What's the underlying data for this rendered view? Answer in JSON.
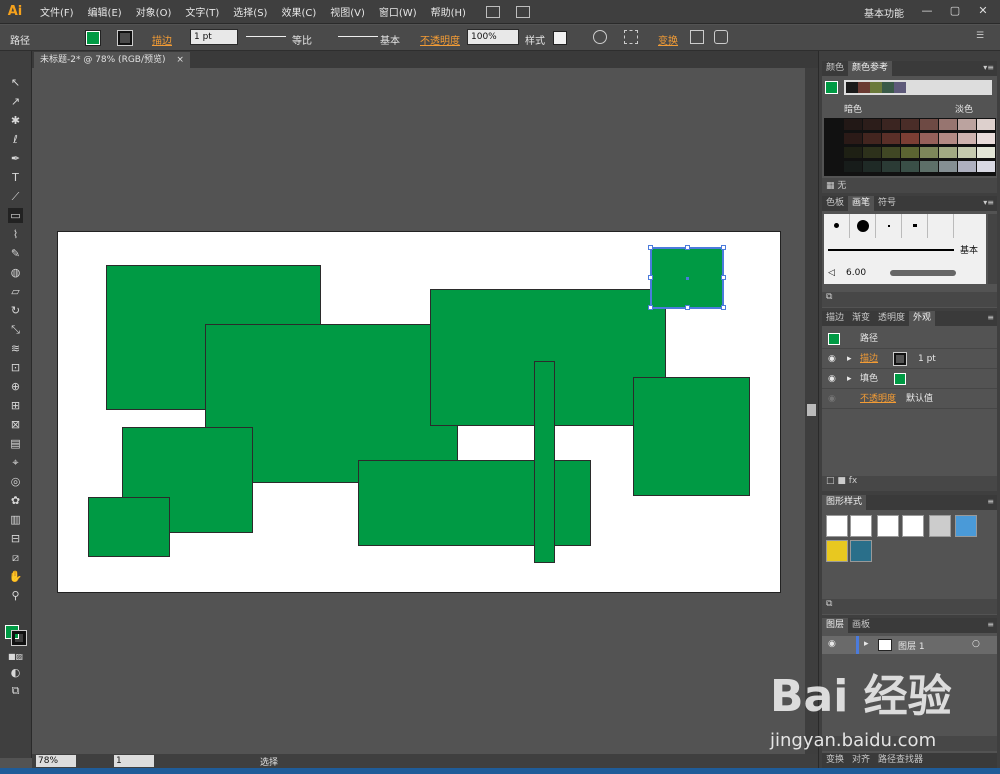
{
  "app": {
    "logo": "Ai",
    "workspace": "基本功能"
  },
  "menubar": {
    "items": [
      "文件(F)",
      "编辑(E)",
      "对象(O)",
      "文字(T)",
      "选择(S)",
      "效果(C)",
      "视图(V)",
      "窗口(W)",
      "帮助(H)"
    ]
  },
  "window_controls": {
    "minimize": "—",
    "maximize": "▢",
    "close": "✕"
  },
  "controlbar": {
    "object_type": "路径",
    "stroke_label": "描边",
    "stroke_weight": "1 pt",
    "profile_uniform": "等比",
    "brush_basic": "基本",
    "opacity_label": "不透明度",
    "opacity_value": "100%",
    "style_label": "样式",
    "transform_label": "变换"
  },
  "document": {
    "tab_title": "未标题-2* @ 78% (RGB/预览)",
    "tab_close": "×"
  },
  "statusbar": {
    "zoom": "78%",
    "page": "1",
    "tool": "选择"
  },
  "panels": {
    "color": {
      "tabs": [
        "颜色",
        "颜色参考"
      ],
      "dark_label": "暗色",
      "light_label": "淡色",
      "none_label": "无"
    },
    "brushes": {
      "tabs": [
        "色板",
        "画笔",
        "符号"
      ],
      "basic_label": "基本",
      "size_value": "6.00"
    },
    "appearance": {
      "tabs": [
        "描边",
        "渐变",
        "透明度",
        "外观"
      ],
      "title": "路径",
      "stroke_label": "描边",
      "stroke_value": "1 pt",
      "fill_label": "填色",
      "opacity_label": "不透明度",
      "opacity_value": "默认值"
    },
    "graphic_styles": {
      "tabs": [
        "图形样式"
      ]
    },
    "layers": {
      "tabs": [
        "图层",
        "画板"
      ],
      "layer_name": "图层 1"
    },
    "bottom": {
      "tabs": [
        "变换",
        "对齐",
        "路径查找器"
      ]
    }
  },
  "colors": {
    "fill": "#009a44",
    "selection": "#4b7bdc",
    "accent_orange": "#f39c35"
  },
  "watermark": {
    "brand": "Bai 经验",
    "url": "jingyan.baidu.com"
  }
}
